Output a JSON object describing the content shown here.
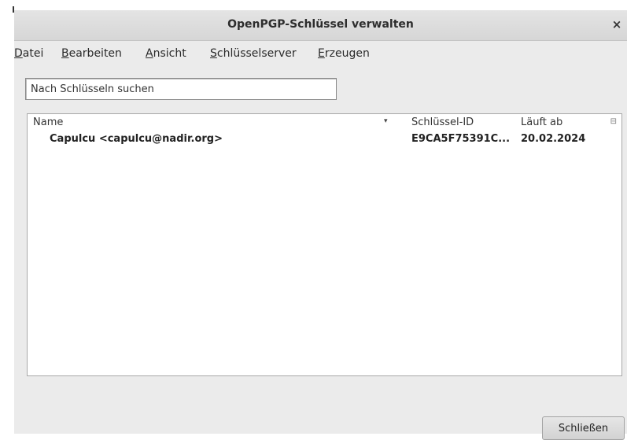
{
  "window": {
    "title": "OpenPGP-Schlüssel verwalten",
    "close_glyph": "×"
  },
  "menu": [
    {
      "mnemonic": "D",
      "rest": "atei"
    },
    {
      "mnemonic": "B",
      "rest": "earbeiten"
    },
    {
      "mnemonic": "A",
      "rest": "nsicht"
    },
    {
      "mnemonic": "S",
      "rest": "chlüsselserver"
    },
    {
      "mnemonic": "E",
      "rest": "rzeugen"
    }
  ],
  "search": {
    "placeholder": "Nach Schlüsseln suchen",
    "value": ""
  },
  "table": {
    "columns": {
      "name": "Name",
      "key_id": "Schlüssel-ID",
      "expires": "Läuft ab"
    },
    "sort_icon": "▾",
    "column_picker_icon": "⊟",
    "rows": [
      {
        "name": "Capulcu <capulcu@nadir.org>",
        "key_id": "E9CA5F75391C...",
        "expires": "20.02.2024"
      }
    ]
  },
  "buttons": {
    "close_label": "Schließen"
  }
}
